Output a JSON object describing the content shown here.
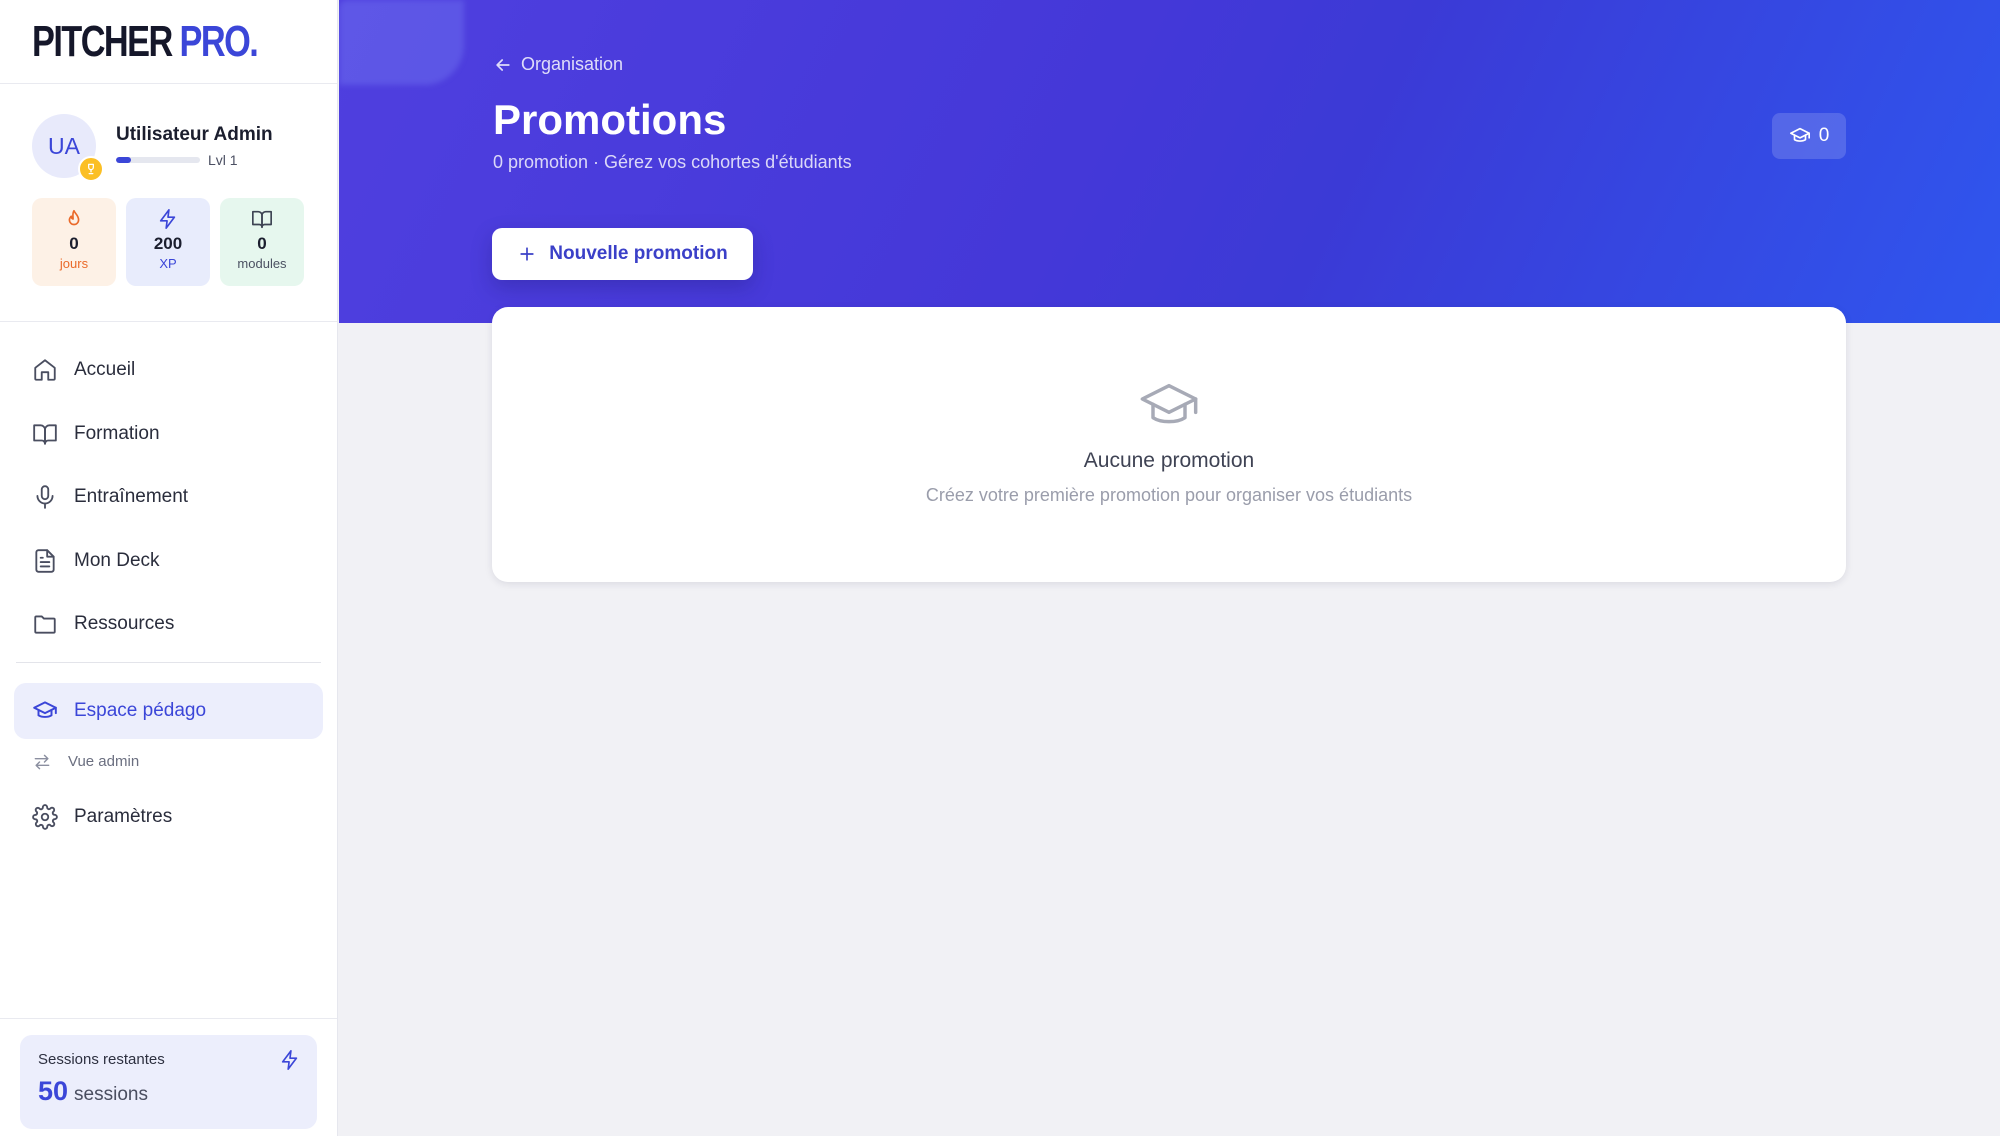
{
  "brand": {
    "logo_part1": "PITCHER",
    "logo_part2": "PRO.",
    "accent": "#3b46d8"
  },
  "profile": {
    "initials": "UA",
    "name": "Utilisateur Admin",
    "level": "Lvl 1",
    "level_progress": 0.18,
    "badge_icon": "trophy-icon"
  },
  "stats": [
    {
      "icon": "flame-icon",
      "value": "0",
      "unit": "jours",
      "color": "#ea6a2a"
    },
    {
      "icon": "bolt-icon",
      "value": "200",
      "unit": "XP",
      "color": "#3b46d8"
    },
    {
      "icon": "book-open-icon",
      "value": "0",
      "unit": "modules",
      "color": "#4b5162"
    }
  ],
  "nav": {
    "items": [
      {
        "label": "Accueil",
        "icon": "home-icon"
      },
      {
        "label": "Formation",
        "icon": "book-open-icon"
      },
      {
        "label": "Entraînement",
        "icon": "microphone-icon"
      },
      {
        "label": "Mon Deck",
        "icon": "document-icon"
      },
      {
        "label": "Ressources",
        "icon": "folder-icon"
      }
    ],
    "active": {
      "label": "Espace pédago",
      "icon": "graduation-cap-icon"
    },
    "sub": {
      "label": "Vue admin",
      "icon": "swap-arrows-icon"
    },
    "settings": {
      "label": "Paramètres",
      "icon": "gear-icon"
    }
  },
  "sessions": {
    "title": "Sessions restantes",
    "count": "50",
    "unit": "sessions"
  },
  "header": {
    "back_label": "Organisation",
    "title": "Promotions",
    "subtitle": "0 promotion · Gérez vos cohortes d'étudiants",
    "count": "0"
  },
  "actions": {
    "new_promotion": "Nouvelle promotion"
  },
  "empty": {
    "title": "Aucune promotion",
    "subtitle": "Créez votre première promotion pour organiser vos étudiants"
  }
}
